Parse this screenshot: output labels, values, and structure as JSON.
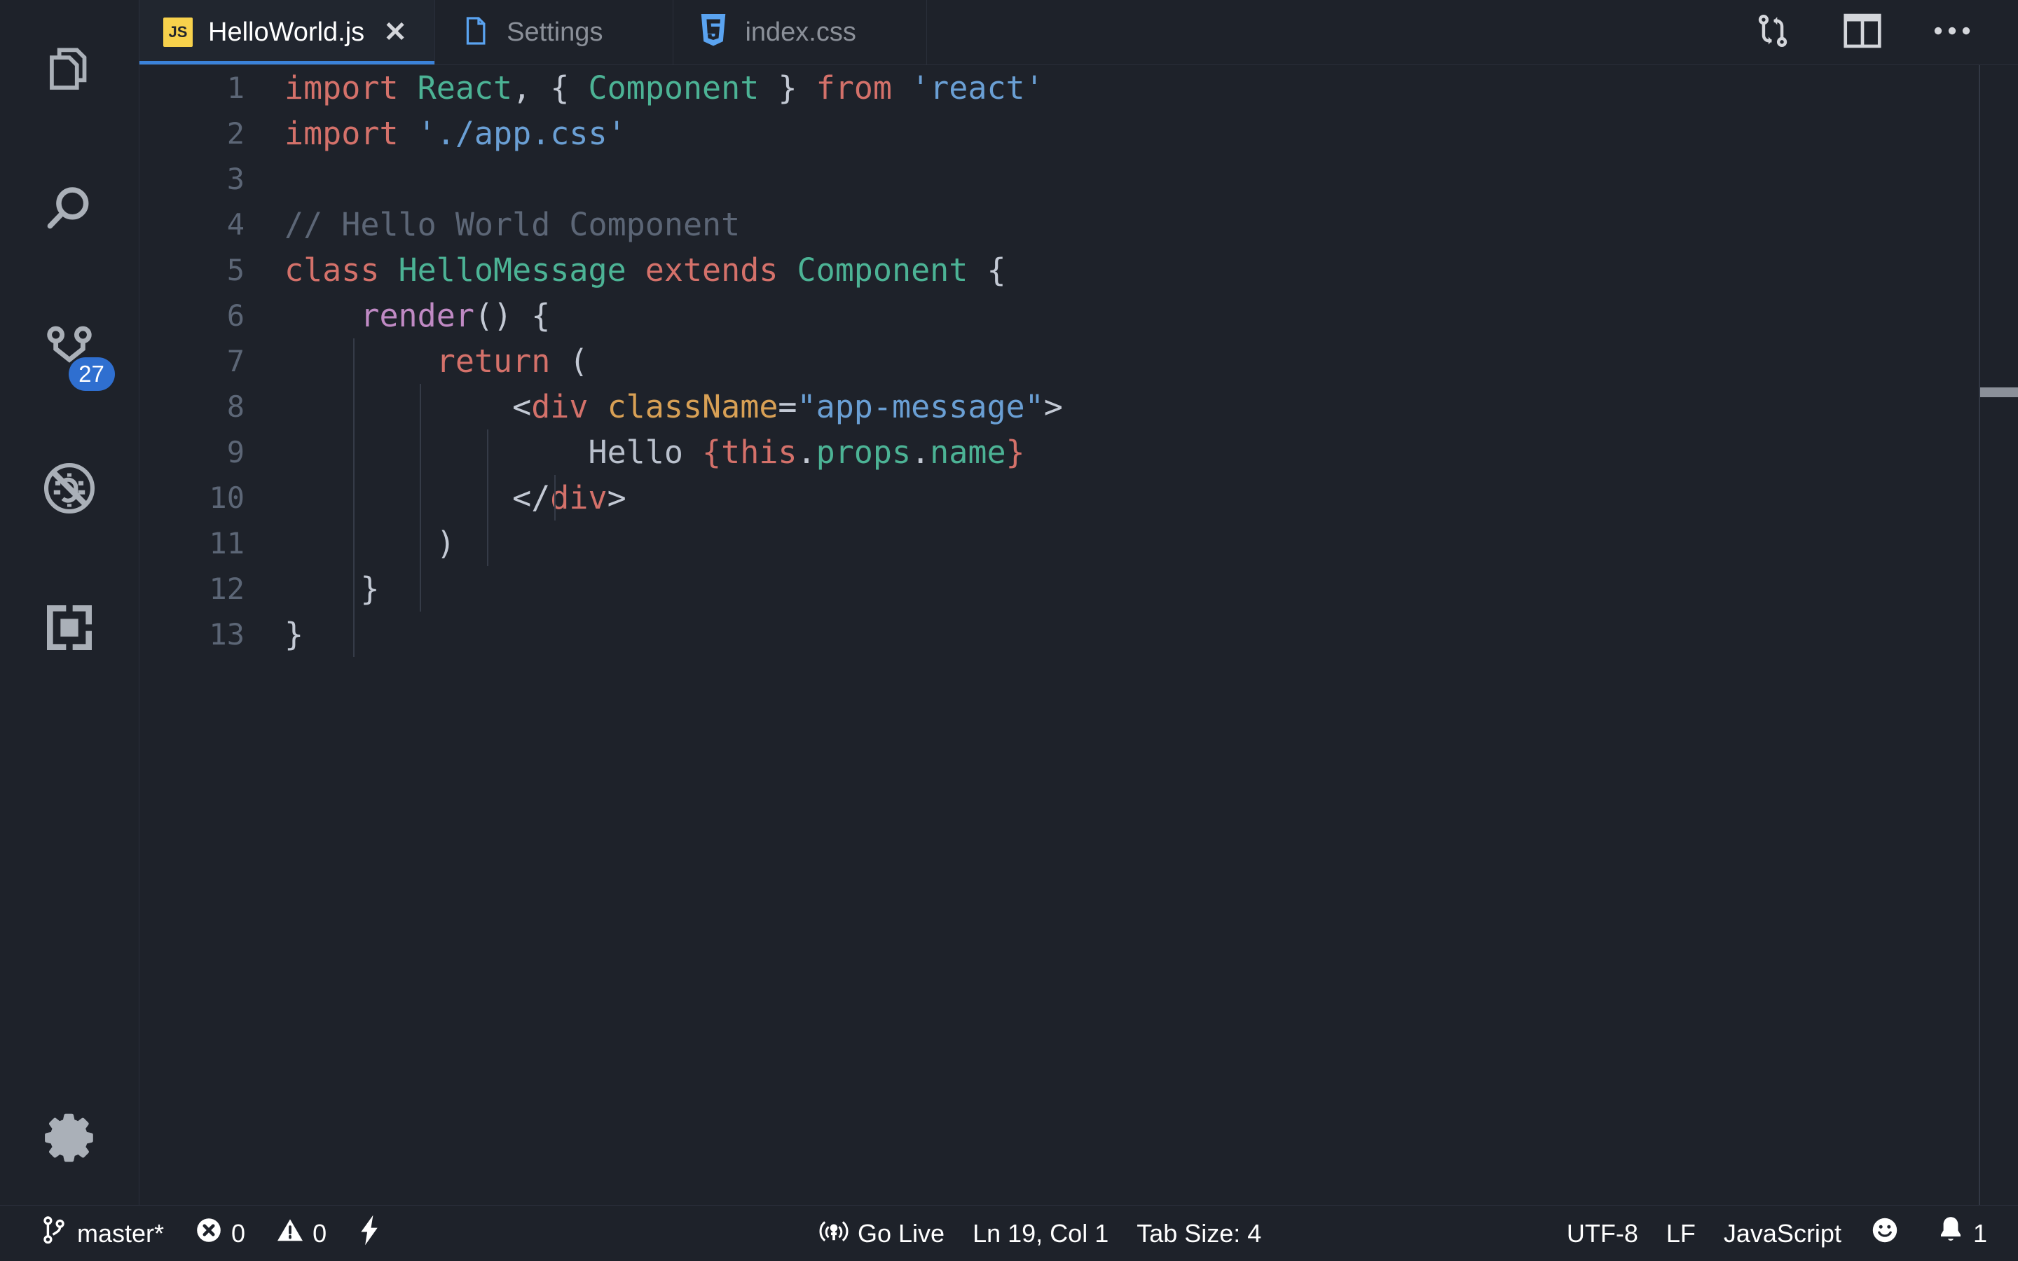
{
  "theme": {
    "bg": "#1e222a",
    "tab_active_bg": "#21262f",
    "accent_blue": "#3b82d9",
    "badge_blue": "#2f6fd0",
    "js_yellow": "#f7d14c",
    "css_blue": "#5aa3f0",
    "text_muted": "#8b9099",
    "line_number": "#5c6676"
  },
  "activity_bar": {
    "items": [
      {
        "name": "explorer",
        "icon": "files-icon",
        "title": "Explorer",
        "badge": null
      },
      {
        "name": "search",
        "icon": "search-icon",
        "title": "Search",
        "badge": null
      },
      {
        "name": "source-control",
        "icon": "source-control-icon",
        "title": "Source Control",
        "badge": "27"
      },
      {
        "name": "run-debug",
        "icon": "debug-disabled-icon",
        "title": "Run and Debug",
        "badge": null
      },
      {
        "name": "extensions",
        "icon": "extensions-icon",
        "title": "Extensions",
        "badge": null
      }
    ],
    "bottom_items": [
      {
        "name": "manage",
        "icon": "gear-icon",
        "title": "Manage"
      }
    ]
  },
  "tabs": [
    {
      "label": "HelloWorld.js",
      "icon": "js-file-icon",
      "icon_text": "JS",
      "active": true,
      "closable": true,
      "close_label": "✕"
    },
    {
      "label": "Settings",
      "icon": "settings-file-icon",
      "active": false,
      "closable": false,
      "close_label": ""
    },
    {
      "label": "index.css",
      "icon": "css-file-icon",
      "active": false,
      "closable": false,
      "close_label": ""
    }
  ],
  "tab_actions": [
    {
      "name": "compare-changes-button",
      "icon": "git-compare-icon",
      "title": "Compare Changes"
    },
    {
      "name": "split-editor-button",
      "icon": "split-editor-icon",
      "title": "Split Editor"
    },
    {
      "name": "more-actions-button",
      "icon": "ellipsis-icon",
      "title": "More Actions..."
    }
  ],
  "editor": {
    "language": "JavaScript",
    "lines": [
      {
        "n": "1",
        "tokens": [
          {
            "t": "import",
            "c": "key"
          },
          {
            "t": " ",
            "c": "plain"
          },
          {
            "t": "React",
            "c": "cls"
          },
          {
            "t": ",",
            "c": "pun"
          },
          {
            "t": " ",
            "c": "plain"
          },
          {
            "t": "{",
            "c": "pun"
          },
          {
            "t": " ",
            "c": "plain"
          },
          {
            "t": "Component",
            "c": "cls"
          },
          {
            "t": " ",
            "c": "plain"
          },
          {
            "t": "}",
            "c": "pun"
          },
          {
            "t": " ",
            "c": "plain"
          },
          {
            "t": "from",
            "c": "key"
          },
          {
            "t": " ",
            "c": "plain"
          },
          {
            "t": "'react'",
            "c": "str"
          }
        ]
      },
      {
        "n": "2",
        "tokens": [
          {
            "t": "import",
            "c": "key"
          },
          {
            "t": " ",
            "c": "plain"
          },
          {
            "t": "'./app.css'",
            "c": "str"
          }
        ]
      },
      {
        "n": "3",
        "tokens": []
      },
      {
        "n": "4",
        "tokens": [
          {
            "t": "// Hello World Component",
            "c": "com"
          }
        ]
      },
      {
        "n": "5",
        "tokens": [
          {
            "t": "class",
            "c": "key"
          },
          {
            "t": " ",
            "c": "plain"
          },
          {
            "t": "HelloMessage",
            "c": "cls"
          },
          {
            "t": " ",
            "c": "plain"
          },
          {
            "t": "extends",
            "c": "key"
          },
          {
            "t": " ",
            "c": "plain"
          },
          {
            "t": "Component",
            "c": "cls"
          },
          {
            "t": " ",
            "c": "plain"
          },
          {
            "t": "{",
            "c": "pun"
          }
        ]
      },
      {
        "n": "6",
        "tokens": [
          {
            "t": "    ",
            "c": "plain"
          },
          {
            "t": "render",
            "c": "fn"
          },
          {
            "t": "() {",
            "c": "pun"
          }
        ]
      },
      {
        "n": "7",
        "tokens": [
          {
            "t": "        ",
            "c": "plain"
          },
          {
            "t": "return",
            "c": "key"
          },
          {
            "t": " ",
            "c": "plain"
          },
          {
            "t": "(",
            "c": "pun"
          }
        ]
      },
      {
        "n": "8",
        "tokens": [
          {
            "t": "            ",
            "c": "plain"
          },
          {
            "t": "<",
            "c": "pun"
          },
          {
            "t": "div",
            "c": "tag"
          },
          {
            "t": " ",
            "c": "plain"
          },
          {
            "t": "className",
            "c": "attr"
          },
          {
            "t": "=",
            "c": "pun"
          },
          {
            "t": "\"app-message\"",
            "c": "str"
          },
          {
            "t": ">",
            "c": "pun"
          }
        ]
      },
      {
        "n": "9",
        "tokens": [
          {
            "t": "                ",
            "c": "plain"
          },
          {
            "t": "Hello ",
            "c": "plain"
          },
          {
            "t": "{this",
            "c": "key"
          },
          {
            "t": ".",
            "c": "pun"
          },
          {
            "t": "props",
            "c": "prop"
          },
          {
            "t": ".",
            "c": "pun"
          },
          {
            "t": "name",
            "c": "prop"
          },
          {
            "t": "}",
            "c": "key"
          }
        ]
      },
      {
        "n": "10",
        "tokens": [
          {
            "t": "            ",
            "c": "plain"
          },
          {
            "t": "</",
            "c": "pun"
          },
          {
            "t": "div",
            "c": "tag"
          },
          {
            "t": ">",
            "c": "pun"
          }
        ]
      },
      {
        "n": "11",
        "tokens": [
          {
            "t": "        ",
            "c": "plain"
          },
          {
            "t": ")",
            "c": "pun"
          }
        ]
      },
      {
        "n": "12",
        "tokens": [
          {
            "t": "    ",
            "c": "plain"
          },
          {
            "t": "}",
            "c": "pun"
          }
        ]
      },
      {
        "n": "13",
        "tokens": [
          {
            "t": "}",
            "c": "pun"
          }
        ]
      }
    ]
  },
  "status_bar": {
    "left": [
      {
        "name": "branch-status",
        "icon": "git-branch-icon",
        "text": "master*"
      },
      {
        "name": "problems-status",
        "icon": "error-icon",
        "text": "0"
      },
      {
        "name": "warnings-status",
        "icon": "warning-icon",
        "text": "0"
      },
      {
        "name": "lightning-status",
        "icon": "lightning-icon",
        "text": ""
      }
    ],
    "center": [
      {
        "name": "go-live-status",
        "icon": "broadcast-icon",
        "text": "Go Live"
      },
      {
        "name": "cursor-position-status",
        "icon": null,
        "text": "Ln 19, Col 1"
      },
      {
        "name": "tab-size-status",
        "icon": null,
        "text": "Tab Size: 4"
      }
    ],
    "right": [
      {
        "name": "encoding-status",
        "icon": null,
        "text": "UTF-8"
      },
      {
        "name": "eol-status",
        "icon": null,
        "text": "LF"
      },
      {
        "name": "language-status",
        "icon": null,
        "text": "JavaScript"
      },
      {
        "name": "feedback-status",
        "icon": "smiley-icon",
        "text": ""
      },
      {
        "name": "notifications-status",
        "icon": "bell-icon",
        "text": "1"
      }
    ]
  }
}
